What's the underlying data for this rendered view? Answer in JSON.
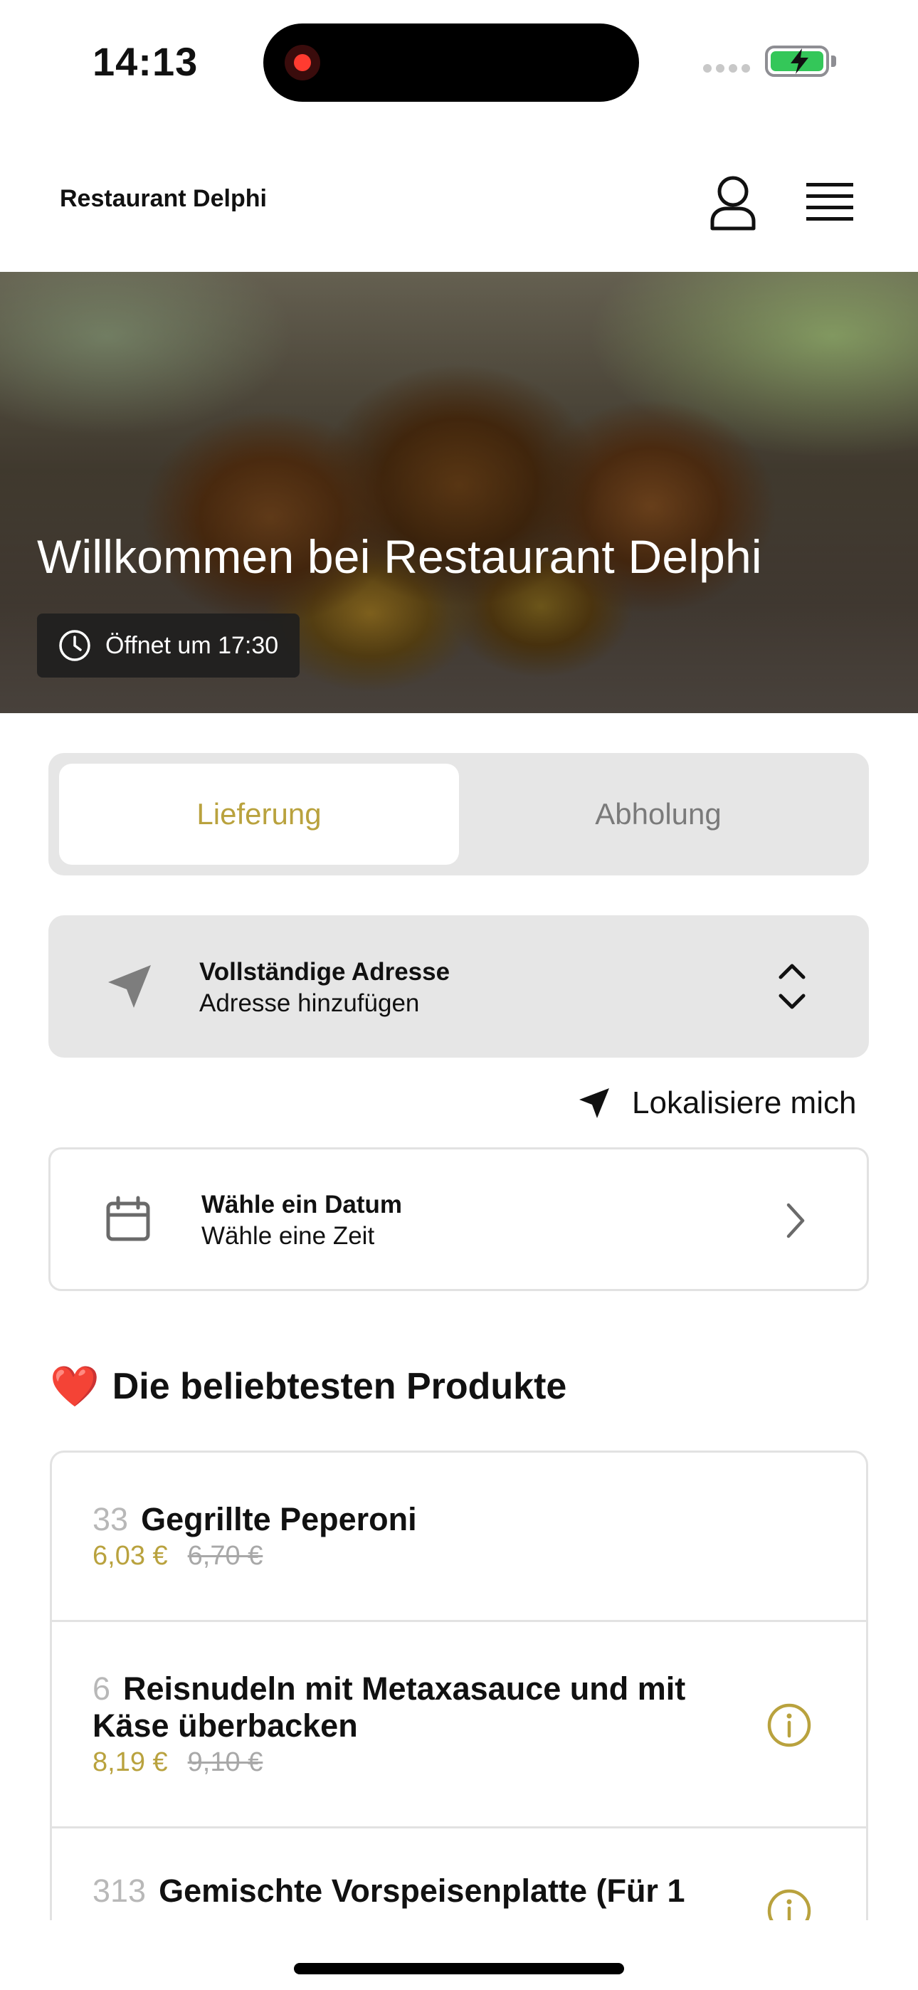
{
  "status_bar": {
    "time": "14:13"
  },
  "header": {
    "brand": "Restaurant Delphi"
  },
  "hero": {
    "title": "Willkommen bei Restaurant Delphi",
    "opening_text": "Öffnet um 17:30"
  },
  "order_mode": {
    "options": [
      "Lieferung",
      "Abholung"
    ],
    "selected": "Lieferung"
  },
  "address": {
    "title": "Vollständige Adresse",
    "subtitle": "Adresse hinzufügen",
    "locate_label": "Lokalisiere mich"
  },
  "schedule": {
    "title": "Wähle ein Datum",
    "subtitle": "Wähle eine Zeit"
  },
  "popular": {
    "title": "Die beliebtesten Produkte",
    "emoji": "❤️",
    "products": [
      {
        "number": "33",
        "name": "Gegrillte Peperoni",
        "price": "6,03 €",
        "old_price": "6,70 €",
        "has_info": false
      },
      {
        "number": "6",
        "name": "Reisnudeln mit Metaxasauce und mit Käse überbacken",
        "price": "8,19 €",
        "old_price": "9,10 €",
        "has_info": true
      },
      {
        "number": "313",
        "name": "Gemischte Vorspeisenplatte (Für 1",
        "price": "",
        "old_price": "",
        "has_info": true
      }
    ]
  },
  "colors": {
    "accent": "#b9a23e",
    "muted": "#7a7a7a",
    "card_bg": "#e6e6e6",
    "border": "#e2e2e2"
  }
}
